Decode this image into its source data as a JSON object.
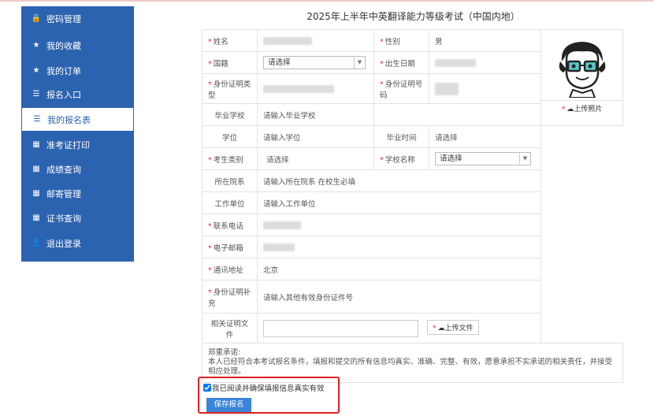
{
  "sidebar": {
    "items": [
      {
        "label": "密码管理",
        "icon": "lock-icon",
        "glyph": "🔒"
      },
      {
        "label": "我的收藏",
        "icon": "star-icon",
        "glyph": "★"
      },
      {
        "label": "我的订单",
        "icon": "star-icon",
        "glyph": "★"
      },
      {
        "label": "报名入口",
        "icon": "list-icon",
        "glyph": "☰"
      },
      {
        "label": "我的报名表",
        "icon": "list-icon",
        "glyph": "☰"
      },
      {
        "label": "准考证打印",
        "icon": "grid-icon",
        "glyph": "▦"
      },
      {
        "label": "成绩查询",
        "icon": "grid-icon",
        "glyph": "▦"
      },
      {
        "label": "邮寄管理",
        "icon": "grid-icon",
        "glyph": "▦"
      },
      {
        "label": "证书查询",
        "icon": "grid-icon",
        "glyph": "▦"
      },
      {
        "label": "退出登录",
        "icon": "user-icon",
        "glyph": "👤"
      }
    ],
    "active_index": 4
  },
  "page": {
    "title": "2025年上半年中英翻译能力等级考试（中国内地）"
  },
  "form": {
    "name_label": "姓名",
    "gender_label": "性别",
    "gender_value": "男",
    "nationality_label": "国籍",
    "nationality_value": "请选择",
    "birthdate_label": "出生日期",
    "idtype_label": "身份证明类型",
    "idnumber_label": "身份证明号码",
    "school_label": "毕业学校",
    "school_placeholder": "请输入毕业学校",
    "degree_label": "学位",
    "degree_placeholder": "请输入学位",
    "gradtime_label": "毕业时间",
    "gradtime_placeholder": "请选择",
    "category_label": "考生类别",
    "category_value": "请选择",
    "schoolname_label": "学校名称",
    "schoolname_value": "请选择",
    "dept_label": "所在院系",
    "dept_placeholder": "请输入所在院系 在校生必填",
    "work_label": "工作单位",
    "work_placeholder": "请输入工作单位",
    "phone_label": "联系电话",
    "email_label": "电子邮箱",
    "address_label": "通讯地址",
    "address_value": "北京",
    "idsupp_label": "身份证明补充",
    "idsupp_placeholder": "请输入其他有效身份证件号",
    "docs_label": "相关证明文件",
    "upload_file_label": "上传文件",
    "upload_photo_label": "上传照片",
    "notice_title": "郑重承诺:",
    "notice_text": "本人已经符合本考试报名条件，填报和提交的所有信息均真实、准确、完整、有效，愿意承担不实承诺的相关责任，并接受相应处理。"
  },
  "bottom": {
    "agree_label": "我已阅读并确保填报信息真实有效",
    "agree_checked": true,
    "save_label": "保存报名"
  },
  "colors": {
    "sidebar_bg": "#2c63b0",
    "required": "#e03030",
    "save_button": "#3a85d8",
    "highlight": "#e02020"
  }
}
